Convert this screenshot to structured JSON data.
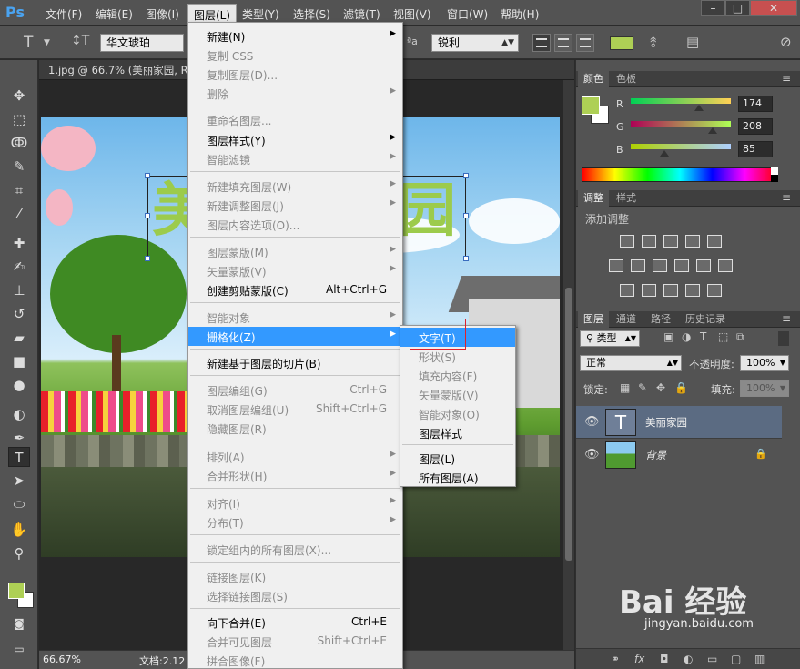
{
  "app": {
    "logo": "Ps"
  },
  "menubar": {
    "items": [
      "文件(F)",
      "编辑(E)",
      "图像(I)",
      "图层(L)",
      "类型(Y)",
      "选择(S)",
      "滤镜(T)",
      "视图(V)",
      "窗口(W)",
      "帮助(H)"
    ],
    "active_index": 3
  },
  "window_controls": {
    "minimize": "–",
    "maximize": "□",
    "close": "✕"
  },
  "options": {
    "font_family": "华文琥珀",
    "antialias": "锐利",
    "text_color": "#aed055",
    "aa_prefix": "ªa"
  },
  "document": {
    "tab_title": "1.jpg @ 66.7% (美丽家园, R",
    "zoom": "66.67%",
    "doc_info": "文档:2.12",
    "big_text_visible": [
      "美",
      "园"
    ]
  },
  "colors": {
    "foreground": "#aed055",
    "background": "#ffffff",
    "menu_highlight": "#3399ff",
    "annotation_red": "#e0212b"
  },
  "color_panel": {
    "tabs": [
      "颜色",
      "色板"
    ],
    "r_label": "R",
    "g_label": "G",
    "b_label": "B",
    "r": "174",
    "g": "208",
    "b": "85",
    "r_value": 174,
    "g_value": 208,
    "b_value": 85
  },
  "adjust_panel": {
    "tabs": [
      "调整",
      "样式"
    ],
    "title": "添加调整"
  },
  "layers_panel": {
    "tabs": [
      "图层",
      "通道",
      "路径",
      "历史记录"
    ],
    "filter": "类型",
    "blend_mode": "正常",
    "opacity_label": "不透明度:",
    "opacity": "100%",
    "lock_label": "锁定:",
    "fill_label": "填充:",
    "fill": "100%",
    "layers": [
      {
        "name": "美丽家园",
        "thumb": "T"
      },
      {
        "name": "背景"
      }
    ]
  },
  "layer_menu": {
    "items": [
      {
        "label": "新建(N)",
        "shortcut": "",
        "sub": true,
        "disabled": false
      },
      {
        "label": "复制 CSS",
        "shortcut": "",
        "sub": false,
        "disabled": true
      },
      {
        "label": "复制图层(D)...",
        "shortcut": "",
        "sub": false,
        "disabled": true
      },
      {
        "label": "删除",
        "shortcut": "",
        "sub": true,
        "disabled": true
      },
      {
        "label": "重命名图层...",
        "shortcut": "",
        "sub": false,
        "disabled": true
      },
      {
        "label": "图层样式(Y)",
        "shortcut": "",
        "sub": true,
        "disabled": false
      },
      {
        "label": "智能滤镜",
        "shortcut": "",
        "sub": true,
        "disabled": true
      },
      {
        "label": "新建填充图层(W)",
        "shortcut": "",
        "sub": true,
        "disabled": true
      },
      {
        "label": "新建调整图层(J)",
        "shortcut": "",
        "sub": true,
        "disabled": true
      },
      {
        "label": "图层内容选项(O)...",
        "shortcut": "",
        "sub": false,
        "disabled": true
      },
      {
        "label": "图层蒙版(M)",
        "shortcut": "",
        "sub": true,
        "disabled": true
      },
      {
        "label": "矢量蒙版(V)",
        "shortcut": "",
        "sub": true,
        "disabled": true
      },
      {
        "label": "创建剪贴蒙版(C)",
        "shortcut": "Alt+Ctrl+G",
        "sub": false,
        "disabled": false
      },
      {
        "label": "智能对象",
        "shortcut": "",
        "sub": true,
        "disabled": true
      },
      {
        "label": "栅格化(Z)",
        "shortcut": "",
        "sub": true,
        "disabled": false,
        "highlighted": true
      },
      {
        "label": "新建基于图层的切片(B)",
        "shortcut": "",
        "sub": false,
        "disabled": false
      },
      {
        "label": "图层编组(G)",
        "shortcut": "Ctrl+G",
        "sub": false,
        "disabled": true
      },
      {
        "label": "取消图层编组(U)",
        "shortcut": "Shift+Ctrl+G",
        "sub": false,
        "disabled": true
      },
      {
        "label": "隐藏图层(R)",
        "shortcut": "",
        "sub": false,
        "disabled": true
      },
      {
        "label": "排列(A)",
        "shortcut": "",
        "sub": true,
        "disabled": true
      },
      {
        "label": "合并形状(H)",
        "shortcut": "",
        "sub": true,
        "disabled": true
      },
      {
        "label": "对齐(I)",
        "shortcut": "",
        "sub": true,
        "disabled": true
      },
      {
        "label": "分布(T)",
        "shortcut": "",
        "sub": true,
        "disabled": true
      },
      {
        "label": "锁定组内的所有图层(X)...",
        "shortcut": "",
        "sub": false,
        "disabled": true
      },
      {
        "label": "链接图层(K)",
        "shortcut": "",
        "sub": false,
        "disabled": true
      },
      {
        "label": "选择链接图层(S)",
        "shortcut": "",
        "sub": false,
        "disabled": true
      },
      {
        "label": "向下合并(E)",
        "shortcut": "Ctrl+E",
        "sub": false,
        "disabled": false
      },
      {
        "label": "合并可见图层",
        "shortcut": "Shift+Ctrl+E",
        "sub": false,
        "disabled": true
      },
      {
        "label": "拼合图像(F)",
        "shortcut": "",
        "sub": false,
        "disabled": true
      }
    ]
  },
  "rasterize_submenu": {
    "items": [
      {
        "label": "文字(T)",
        "disabled": false,
        "highlighted": true
      },
      {
        "label": "形状(S)",
        "disabled": true
      },
      {
        "label": "填充内容(F)",
        "disabled": true
      },
      {
        "label": "矢量蒙版(V)",
        "disabled": true
      },
      {
        "label": "智能对象(O)",
        "disabled": true
      },
      {
        "label": "图层样式",
        "disabled": false
      },
      {
        "label": "图层(L)",
        "disabled": false
      },
      {
        "label": "所有图层(A)",
        "disabled": false
      }
    ]
  },
  "watermark": {
    "logo": "Bai 经验",
    "url": "jingyan.baidu.com"
  }
}
